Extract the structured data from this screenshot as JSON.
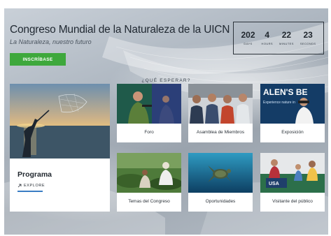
{
  "header": {
    "title": "Congreso Mundial de la Naturaleza de la UICN",
    "subtitle": "La Naturaleza, nuestro futuro",
    "cta_label": "INSCRÍBASE"
  },
  "countdown": [
    {
      "value": "202",
      "unit": "DAYS"
    },
    {
      "value": "4",
      "unit": "HOURS"
    },
    {
      "value": "22",
      "unit": "MINUTES"
    },
    {
      "value": "23",
      "unit": "SECONDS"
    }
  ],
  "section": {
    "label": "¿QUÉ ESPERAR?"
  },
  "featured": {
    "title": "Programa",
    "link_label": "EXPLORE"
  },
  "cards": [
    {
      "label": "Foro"
    },
    {
      "label": "Asamblea de Miembros"
    },
    {
      "label": "Exposición"
    },
    {
      "label": "Temas del Congreso"
    },
    {
      "label": "Oportunidades"
    },
    {
      "label": "Visitante del público"
    }
  ],
  "photo_text": {
    "exposicion_banner": "ALEN'S BE",
    "exposicion_sub": "Experience nature in",
    "visitante_sign": "USA"
  },
  "colors": {
    "cta": "#3ea83c",
    "accent_line": "#3a7dc4",
    "text_dark": "#222a33"
  }
}
